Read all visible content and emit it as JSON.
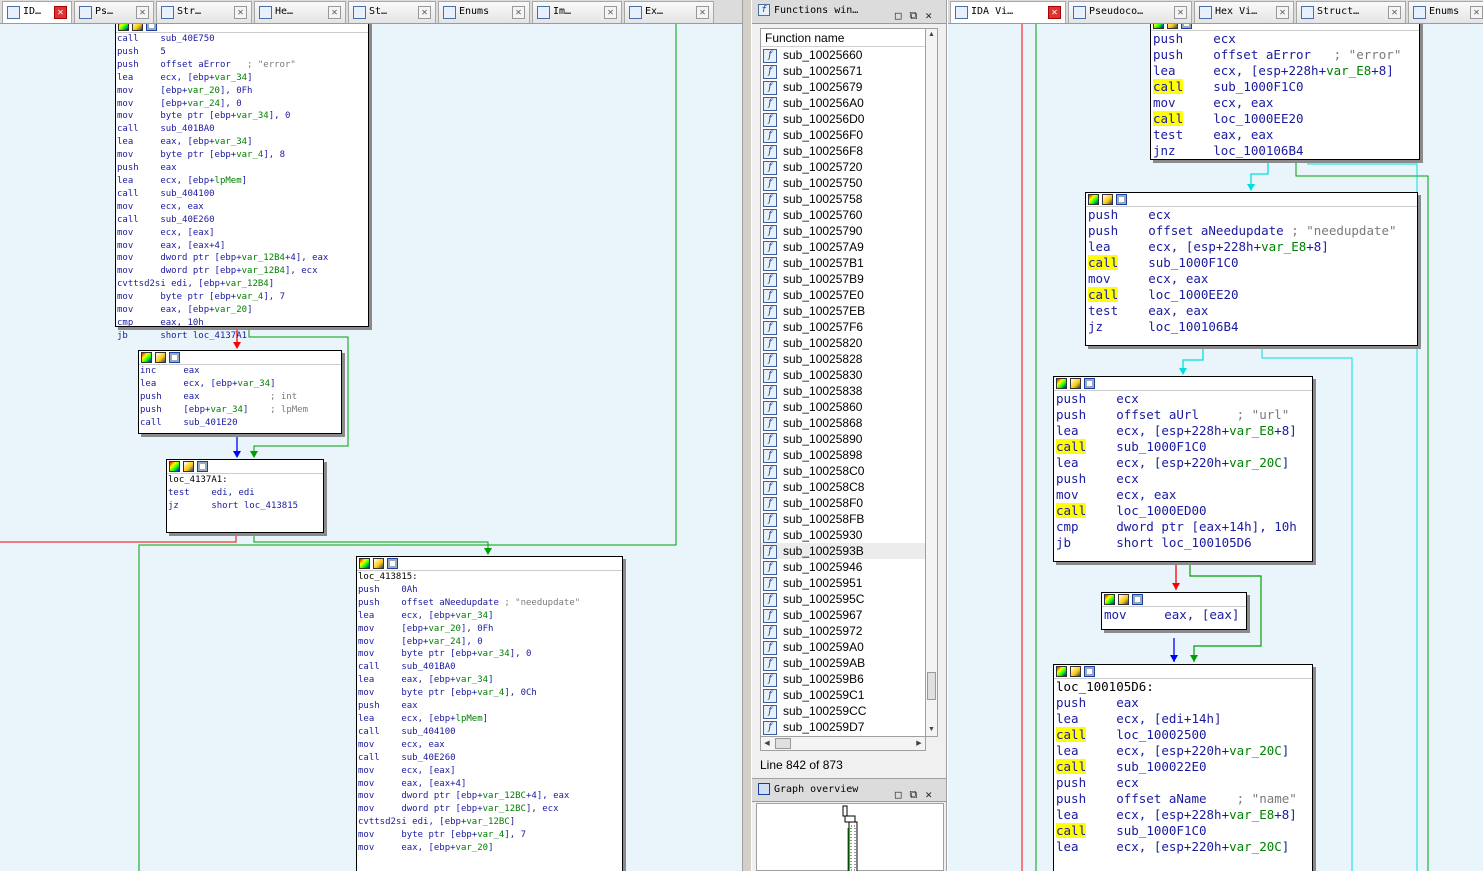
{
  "left_tabs": [
    {
      "label": "ID…",
      "icon": "ida-view-icon",
      "active": true
    },
    {
      "label": "Ps…",
      "icon": "pseudocode-icon"
    },
    {
      "label": "Str…",
      "icon": "strings-icon"
    },
    {
      "label": "He…",
      "icon": "hex-view-icon"
    },
    {
      "label": "St…",
      "icon": "structures-icon"
    },
    {
      "label": "Enums",
      "icon": "enums-icon"
    },
    {
      "label": "Im…",
      "icon": "imports-icon"
    },
    {
      "label": "Ex…",
      "icon": "exports-icon"
    }
  ],
  "left_blocks": [
    {
      "lines": [
        "call    sub_40E750",
        "push    5",
        "push    offset aError   ; \"error\"",
        "lea     ecx, [ebp+var_34]",
        "mov     [ebp+var_20], 0Fh",
        "mov     [ebp+var_24], 0",
        "mov     byte ptr [ebp+var_34], 0",
        "call    sub_401BA0",
        "lea     eax, [ebp+var_34]",
        "mov     byte ptr [ebp+var_4], 8",
        "push    eax",
        "lea     ecx, [ebp+lpMem]",
        "call    sub_404100",
        "mov     ecx, eax",
        "call    sub_40E260",
        "mov     ecx, [eax]",
        "mov     eax, [eax+4]",
        "mov     dword ptr [ebp+var_12B4+4], eax",
        "mov     dword ptr [ebp+var_12B4], ecx",
        "cvttsd2si edi, [ebp+var_12B4]",
        "mov     byte ptr [ebp+var_4], 7",
        "mov     eax, [ebp+var_20]",
        "cmp     eax, 10h",
        "jb      short loc_4137A1"
      ]
    },
    {
      "lines": [
        "inc     eax",
        "lea     ecx, [ebp+var_34]",
        "push    eax             ; int",
        "push    [ebp+var_34]    ; lpMem",
        "call    sub_401E20"
      ]
    },
    {
      "lines": [
        "",
        "loc_4137A1:",
        "test    edi, edi",
        "jz      short loc_413815"
      ]
    },
    {
      "lines": [
        "",
        "loc_413815:",
        "push    0Ah",
        "push    offset aNeedupdate ; \"needupdate\"",
        "lea     ecx, [ebp+var_34]",
        "mov     [ebp+var_20], 0Fh",
        "mov     [ebp+var_24], 0",
        "mov     byte ptr [ebp+var_34], 0",
        "call    sub_401BA0",
        "lea     eax, [ebp+var_34]",
        "mov     byte ptr [ebp+var_4], 0Ch",
        "push    eax",
        "lea     ecx, [ebp+lpMem]",
        "call    sub_404100",
        "mov     ecx, eax",
        "call    sub_40E260",
        "mov     ecx, [eax]",
        "mov     eax, [eax+4]",
        "mov     dword ptr [ebp+var_12BC+4], eax",
        "mov     dword ptr [ebp+var_12BC], ecx",
        "cvttsd2si edi, [ebp+var_12BC]",
        "mov     byte ptr [ebp+var_4], 7",
        "mov     eax, [ebp+var_20]"
      ]
    }
  ],
  "functions_window": {
    "title": "Functions win…",
    "column_header": "Function name",
    "functions": [
      "sub_10025660",
      "sub_10025671",
      "sub_10025679",
      "sub_100256A0",
      "sub_100256D0",
      "sub_100256F0",
      "sub_100256F8",
      "sub_10025720",
      "sub_10025750",
      "sub_10025758",
      "sub_10025760",
      "sub_10025790",
      "sub_100257A9",
      "sub_100257B1",
      "sub_100257B9",
      "sub_100257E0",
      "sub_100257EB",
      "sub_100257F6",
      "sub_10025820",
      "sub_10025828",
      "sub_10025830",
      "sub_10025838",
      "sub_10025860",
      "sub_10025868",
      "sub_10025890",
      "sub_10025898",
      "sub_100258C0",
      "sub_100258C8",
      "sub_100258F0",
      "sub_100258FB",
      "sub_10025930",
      "sub_1002593B",
      "sub_10025946",
      "sub_10025951",
      "sub_1002595C",
      "sub_10025967",
      "sub_10025972",
      "sub_100259A0",
      "sub_100259AB",
      "sub_100259B6",
      "sub_100259C1",
      "sub_100259CC",
      "sub_100259D7"
    ],
    "selected_index": 31,
    "status": "Line 842 of 873",
    "function_icon": "function-icon"
  },
  "graph_overview": {
    "title": "Graph overview"
  },
  "right_tabs": [
    {
      "label": "IDA Vi…",
      "icon": "ida-view-icon",
      "active": true
    },
    {
      "label": "Pseudoco…",
      "icon": "pseudocode-icon"
    },
    {
      "label": "Hex Vi…",
      "icon": "hex-view-icon"
    },
    {
      "label": "Struct…",
      "icon": "structures-icon"
    },
    {
      "label": "Enums",
      "icon": "enums-icon"
    }
  ],
  "right_blocks": [
    {
      "lines": [
        "push    ecx",
        "push    offset aError   ; \"error\"",
        "lea     ecx, [esp+228h+var_E8+8]",
        "call    sub_1000F1C0",
        "mov     ecx, eax",
        "call    loc_1000EE20",
        "test    eax, eax",
        "jnz     loc_100106B4"
      ]
    },
    {
      "lines": [
        "push    ecx",
        "push    offset aNeedupdate ; \"needupdate\"",
        "lea     ecx, [esp+228h+var_E8+8]",
        "call    sub_1000F1C0",
        "mov     ecx, eax",
        "call    loc_1000EE20",
        "test    eax, eax",
        "jz      loc_100106B4"
      ]
    },
    {
      "lines": [
        "push    ecx",
        "push    offset aUrl     ; \"url\"",
        "lea     ecx, [esp+228h+var_E8+8]",
        "call    sub_1000F1C0",
        "lea     ecx, [esp+220h+var_20C]",
        "push    ecx",
        "mov     ecx, eax",
        "call    loc_1000ED00",
        "cmp     dword ptr [eax+14h], 10h",
        "jb      short loc_100105D6"
      ]
    },
    {
      "lines": [
        "mov     eax, [eax]"
      ]
    },
    {
      "lines": [
        "",
        "loc_100105D6:",
        "push    eax",
        "lea     ecx, [edi+14h]",
        "call    loc_10002500",
        "lea     ecx, [esp+220h+var_20C]",
        "call    sub_100022E0",
        "push    ecx",
        "push    offset aName    ; \"name\"",
        "lea     ecx, [esp+228h+var_E8+8]",
        "call    sub_1000F1C0",
        "lea     ecx, [esp+220h+var_20C]"
      ]
    }
  ],
  "colors": {
    "graph_bg": "#e9f5fb",
    "edge_true": "#00a000",
    "edge_false": "#ff0000",
    "edge_flow": "#0000ff",
    "edge_cyan": "#00e0e0",
    "call_highlight": "#ffff00"
  }
}
